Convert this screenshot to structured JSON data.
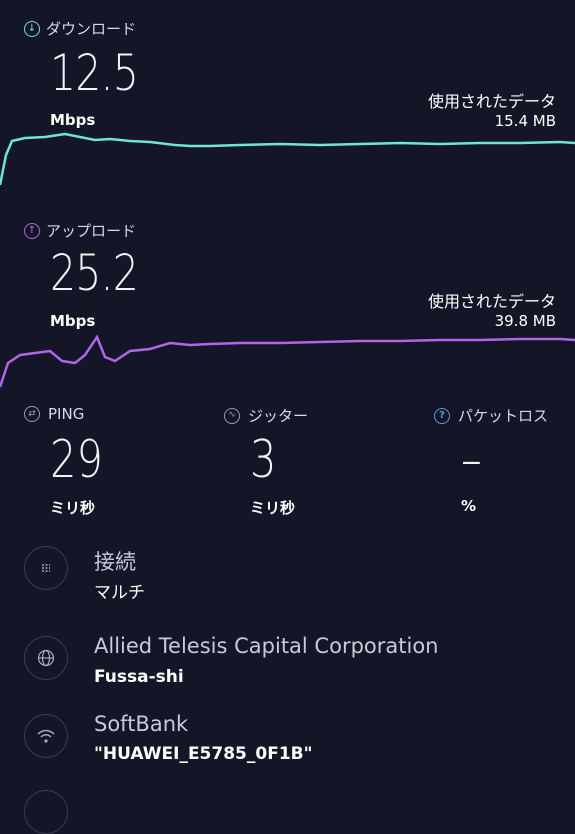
{
  "download": {
    "label": "ダウンロード",
    "value": "12.5",
    "unit": "Mbps",
    "used_label": "使用されたデータ",
    "used_value": "15.4 MB",
    "color": "#6fe4d4"
  },
  "upload": {
    "label": "アップロード",
    "value": "25.2",
    "unit": "Mbps",
    "used_label": "使用されたデータ",
    "used_value": "39.8 MB",
    "color": "#b266e6"
  },
  "metrics": {
    "ping": {
      "label": "PING",
      "value": "29",
      "unit": "ミリ秒"
    },
    "jitter": {
      "label": "ジッター",
      "value": "3",
      "unit": "ミリ秒"
    },
    "packet_loss": {
      "label": "パケットロス",
      "value": "–",
      "unit": "%"
    }
  },
  "info": {
    "connection": {
      "title": "接続",
      "sub": "マルチ",
      "icon": "connection-icon"
    },
    "provider": {
      "title": "Allied Telesis Capital Corporation",
      "sub": "Fussa-shi",
      "icon": "globe-icon"
    },
    "network": {
      "title": "SoftBank",
      "sub": "\"HUAWEI_E5785_0F1B\"",
      "icon": "wifi-icon"
    }
  }
}
